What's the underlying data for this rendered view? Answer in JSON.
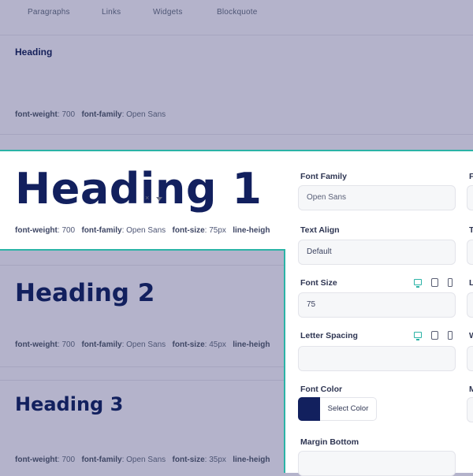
{
  "tabs": [
    "Paragraphs",
    "Links",
    "Widgets",
    "Blockquote"
  ],
  "heading_section": {
    "label": "Heading",
    "meta": {
      "fw_key": "font-weight",
      "fw_val": "700",
      "ff_key": "font-family",
      "ff_val": "Open Sans"
    }
  },
  "h1": {
    "text": "Heading 1",
    "meta": {
      "fw_key": "font-weight",
      "fw_val": "700",
      "ff_key": "font-family",
      "ff_val": "Open Sans",
      "fs_key": "font-size",
      "fs_val": "75px",
      "lh_key": "line-heigh"
    }
  },
  "h2": {
    "text": "Heading 2",
    "meta": {
      "fw_key": "font-weight",
      "fw_val": "700",
      "ff_key": "font-family",
      "ff_val": "Open Sans",
      "fs_key": "font-size",
      "fs_val": "45px",
      "lh_key": "line-heigh"
    }
  },
  "h3": {
    "text": "Heading 3",
    "meta": {
      "fw_key": "font-weight",
      "fw_val": "700",
      "ff_key": "font-family",
      "ff_val": "Open Sans",
      "fs_key": "font-size",
      "fs_val": "35px",
      "lh_key": "line-heigh"
    }
  },
  "panel": {
    "font_family": {
      "label": "Font Family",
      "value": "Open Sans",
      "clear": "×"
    },
    "text_align": {
      "label": "Text Align",
      "value": "Default"
    },
    "font_size": {
      "label": "Font Size",
      "value": "75"
    },
    "letter_spacing": {
      "label": "Letter Spacing",
      "value": ""
    },
    "font_color": {
      "label": "Font Color",
      "button": "Select Color",
      "swatch": "#12205e"
    },
    "margin_bottom": {
      "label": "Margin Bottom"
    },
    "edge_labels": [
      "F",
      "T",
      "L",
      "W",
      "M"
    ]
  },
  "colors": {
    "accent": "#2bb3a6",
    "heading": "#12205e",
    "overlay": "#b4b3cb"
  }
}
